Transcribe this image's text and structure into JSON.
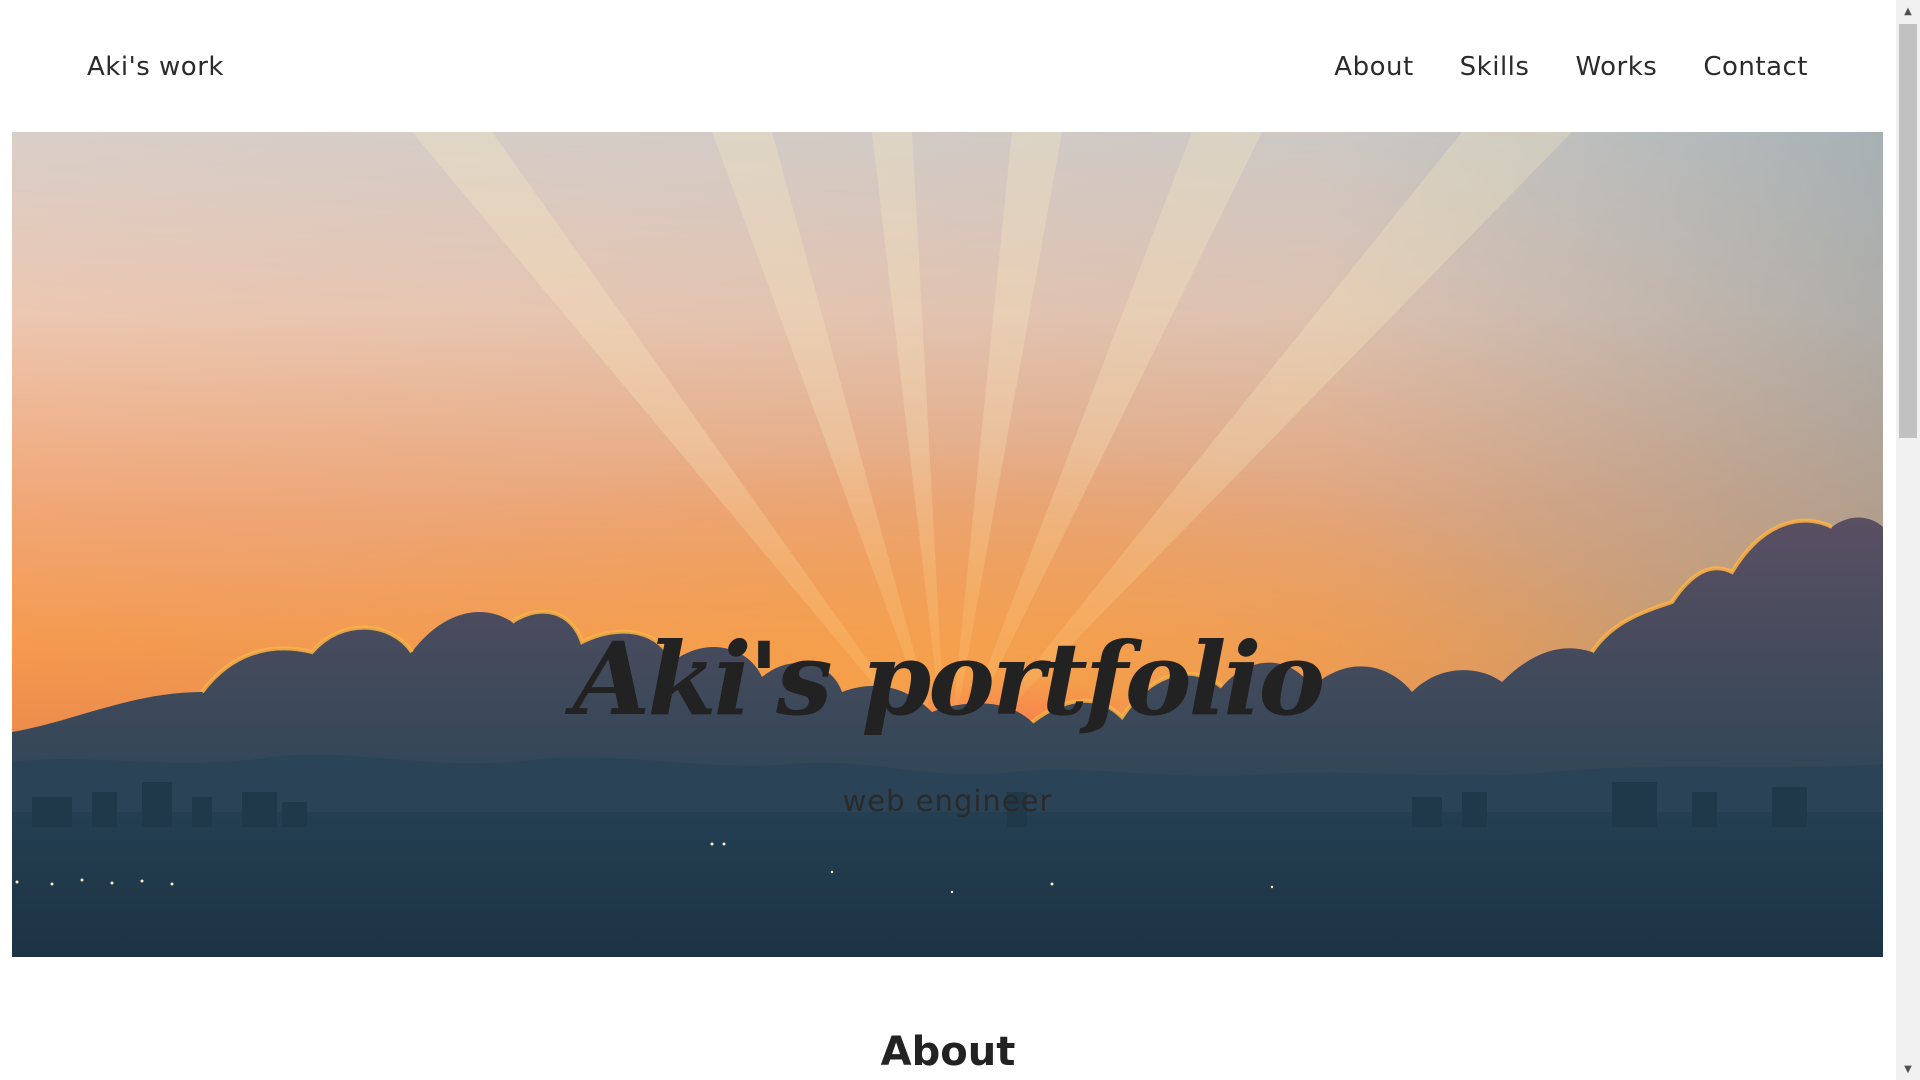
{
  "header": {
    "brand": "Aki's work",
    "nav": [
      {
        "label": "About"
      },
      {
        "label": "Skills"
      },
      {
        "label": "Works"
      },
      {
        "label": "Contact"
      }
    ]
  },
  "hero": {
    "title": "Aki's portfolio",
    "subtitle": "web engineer",
    "image": "sunset-over-city-skyline"
  },
  "about": {
    "heading": "About"
  },
  "scrollbar": {
    "up_icon": "chevron-up-icon",
    "down_icon": "chevron-down-icon"
  }
}
